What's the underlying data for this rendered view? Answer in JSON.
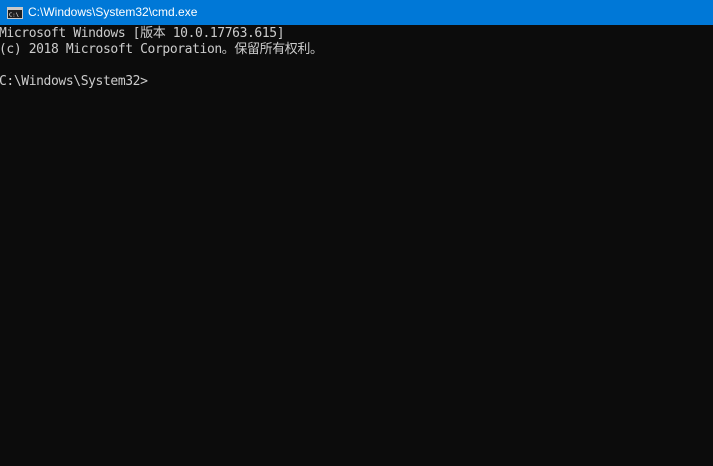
{
  "window": {
    "title": "C:\\Windows\\System32\\cmd.exe",
    "app_icon": "cmd-icon",
    "titlebar_color": "#0078d7",
    "background_color": "#0c0c0c",
    "text_color": "#cccccc"
  },
  "console": {
    "lines": [
      "Microsoft Windows [版本 10.0.17763.615]",
      "(c) 2018 Microsoft Corporation。保留所有权利。"
    ],
    "prompt": "C:\\Windows\\System32>"
  }
}
